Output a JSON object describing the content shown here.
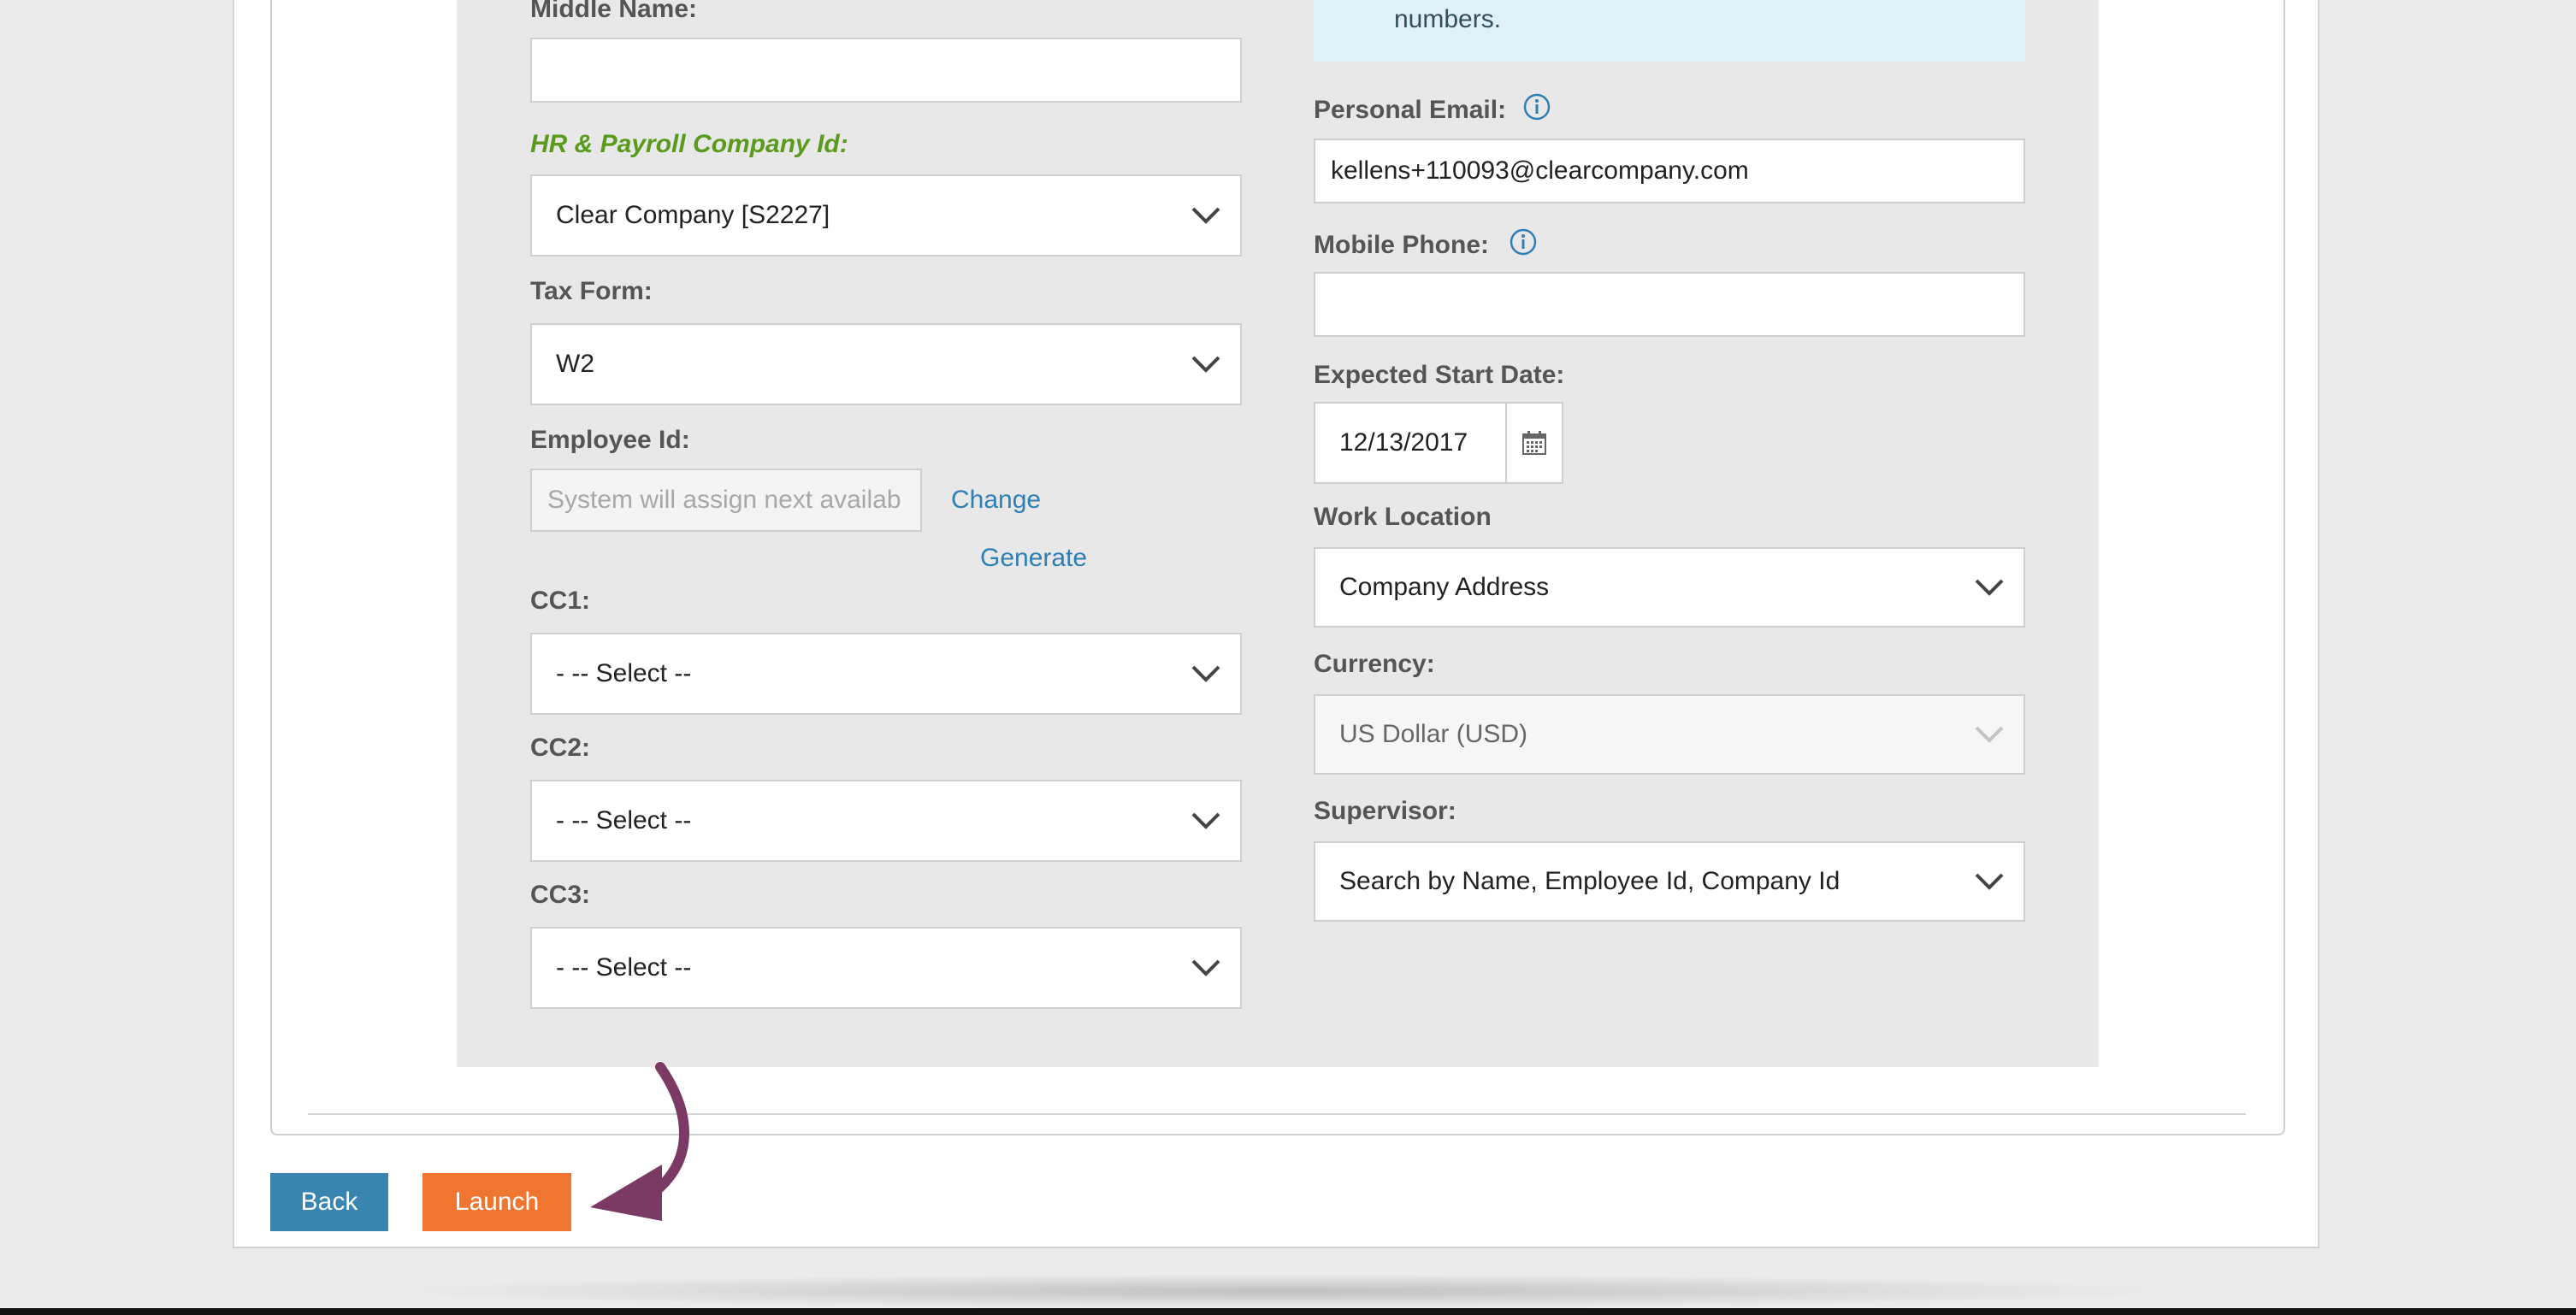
{
  "notice": {
    "text": "numbers."
  },
  "left": {
    "middle_name": {
      "label": "Middle Name:",
      "value": ""
    },
    "hr_company": {
      "label": "HR & Payroll Company Id:",
      "value": "Clear Company [S2227]"
    },
    "tax_form": {
      "label": "Tax Form:",
      "value": "W2"
    },
    "employee_id": {
      "label": "Employee Id:",
      "placeholder": "System will assign next availab",
      "change_label": "Change",
      "generate_label": "Generate"
    },
    "cc1": {
      "label": "CC1:",
      "value": "- -- Select --"
    },
    "cc2": {
      "label": "CC2:",
      "value": "- -- Select --"
    },
    "cc3": {
      "label": "CC3:",
      "value": "- -- Select --"
    }
  },
  "right": {
    "personal_email": {
      "label": "Personal Email:",
      "value": "kellens+110093@clearcompany.com"
    },
    "mobile_phone": {
      "label": "Mobile Phone:",
      "value": ""
    },
    "start_date": {
      "label": "Expected Start Date:",
      "value": "12/13/2017"
    },
    "work_location": {
      "label": "Work Location",
      "value": "Company Address"
    },
    "currency": {
      "label": "Currency:",
      "value": "US Dollar (USD)"
    },
    "supervisor": {
      "label": "Supervisor:",
      "value": "Search by Name, Employee Id, Company Id"
    }
  },
  "buttons": {
    "back": "Back",
    "launch": "Launch"
  },
  "colors": {
    "primary": "#3a84b0",
    "accent": "#f07530",
    "hr_label": "#5a9a1c",
    "annotation_arrow": "#7b3a64"
  },
  "icons": {
    "info": "info-circle-icon",
    "calendar": "calendar-icon",
    "chevron": "chevron-down-icon"
  }
}
